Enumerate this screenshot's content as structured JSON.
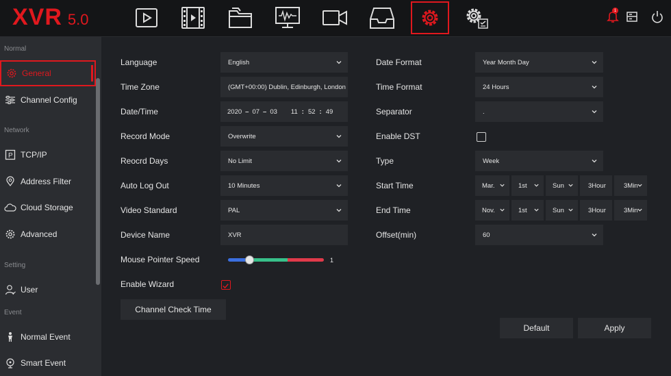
{
  "logo": {
    "main": "XVR",
    "version": "5.0"
  },
  "top_nav": [
    "live-view-icon",
    "playback-icon",
    "file-manager-icon",
    "monitor-icon",
    "camera-icon",
    "backup-icon",
    "settings-icon",
    "advanced-settings-icon"
  ],
  "top_right": {
    "alarm_icon": "alarm-bell-icon",
    "alarm_badge": "1",
    "disk_icon": "disk-icon",
    "power_icon": "power-icon"
  },
  "colors": {
    "accent": "#e0181e",
    "panel": "#2a2c30",
    "sidebar": "#2b2d31",
    "background": "#1f2125"
  },
  "sidebar": {
    "sections": [
      {
        "label": "Normal",
        "items": [
          {
            "label": "General",
            "icon": "gear-icon",
            "active": true
          },
          {
            "label": "Channel Config",
            "icon": "sliders-icon"
          }
        ]
      },
      {
        "label": "Network",
        "items": [
          {
            "label": "TCP/IP",
            "icon": "tcpip-icon"
          },
          {
            "label": "Address Filter",
            "icon": "location-pin-icon"
          },
          {
            "label": "Cloud Storage",
            "icon": "cloud-icon"
          },
          {
            "label": "Advanced",
            "icon": "advanced-gear-icon"
          }
        ]
      },
      {
        "label": "Setting",
        "items": [
          {
            "label": "User",
            "icon": "user-icon"
          }
        ]
      },
      {
        "label": "Event",
        "items": [
          {
            "label": "Normal Event",
            "icon": "person-event-icon"
          },
          {
            "label": "Smart Event",
            "icon": "smart-event-icon"
          }
        ]
      }
    ]
  },
  "left_form": {
    "language": {
      "label": "Language",
      "value": "English"
    },
    "time_zone": {
      "label": "Time Zone",
      "value": "(GMT+00:00) Dublin, Edinburgh, London"
    },
    "date_time": {
      "label": "Date/Time",
      "year": "2020",
      "month": "07",
      "day": "03",
      "hour": "11",
      "minute": "52",
      "second": "49",
      "date_sep": "–",
      "time_sep": ":"
    },
    "record_mode": {
      "label": "Record Mode",
      "value": "Overwrite"
    },
    "record_days": {
      "label": "Reocrd Days",
      "value": "No Limit"
    },
    "auto_logout": {
      "label": "Auto Log Out",
      "value": "10 Minutes"
    },
    "video_standard": {
      "label": "Video Standard",
      "value": "PAL"
    },
    "device_name": {
      "label": "Device Name",
      "value": "XVR"
    },
    "mouse_speed": {
      "label": "Mouse Pointer Speed",
      "value": "1",
      "level_fraction": 0.22
    },
    "enable_wizard": {
      "label": "Enable Wizard",
      "checked": true
    },
    "channel_check_button": "Channel Check Time"
  },
  "right_form": {
    "date_format": {
      "label": "Date Format",
      "value": "Year Month Day"
    },
    "time_format": {
      "label": "Time Format",
      "value": "24 Hours"
    },
    "separator": {
      "label": "Separator",
      "value": "."
    },
    "enable_dst": {
      "label": "Enable DST",
      "checked": false
    },
    "type": {
      "label": "Type",
      "value": "Week"
    },
    "start_time": {
      "label": "Start Time",
      "month": "Mar.",
      "week": "1st",
      "day": "Sun",
      "hour": "3Hour",
      "minute": "3Min"
    },
    "end_time": {
      "label": "End Time",
      "month": "Nov.",
      "week": "1st",
      "day": "Sun",
      "hour": "3Hour",
      "minute": "3Min"
    },
    "offset": {
      "label": "Offset(min)",
      "value": "60"
    }
  },
  "buttons": {
    "default": "Default",
    "apply": "Apply"
  }
}
